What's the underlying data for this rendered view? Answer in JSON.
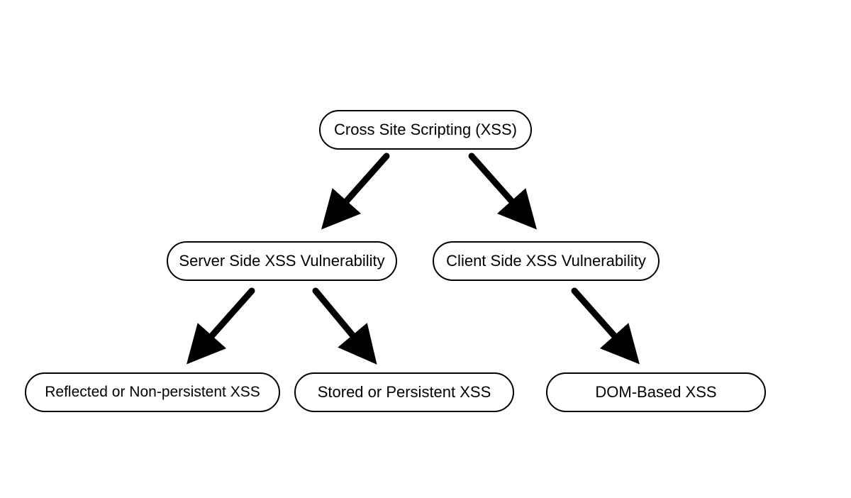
{
  "diagram": {
    "title": "Cross Site Scripting (XSS)",
    "nodes": {
      "root": "Cross Site Scripting (XSS)",
      "server": "Server Side XSS Vulnerability",
      "client": "Client Side XSS Vulnerability",
      "reflected": "Reflected or Non-persistent XSS",
      "stored": "Stored or Persistent XSS",
      "dom": "DOM-Based XSS"
    },
    "edges": [
      {
        "from": "root",
        "to": "server"
      },
      {
        "from": "root",
        "to": "client"
      },
      {
        "from": "server",
        "to": "reflected"
      },
      {
        "from": "server",
        "to": "stored"
      },
      {
        "from": "client",
        "to": "dom"
      }
    ]
  }
}
